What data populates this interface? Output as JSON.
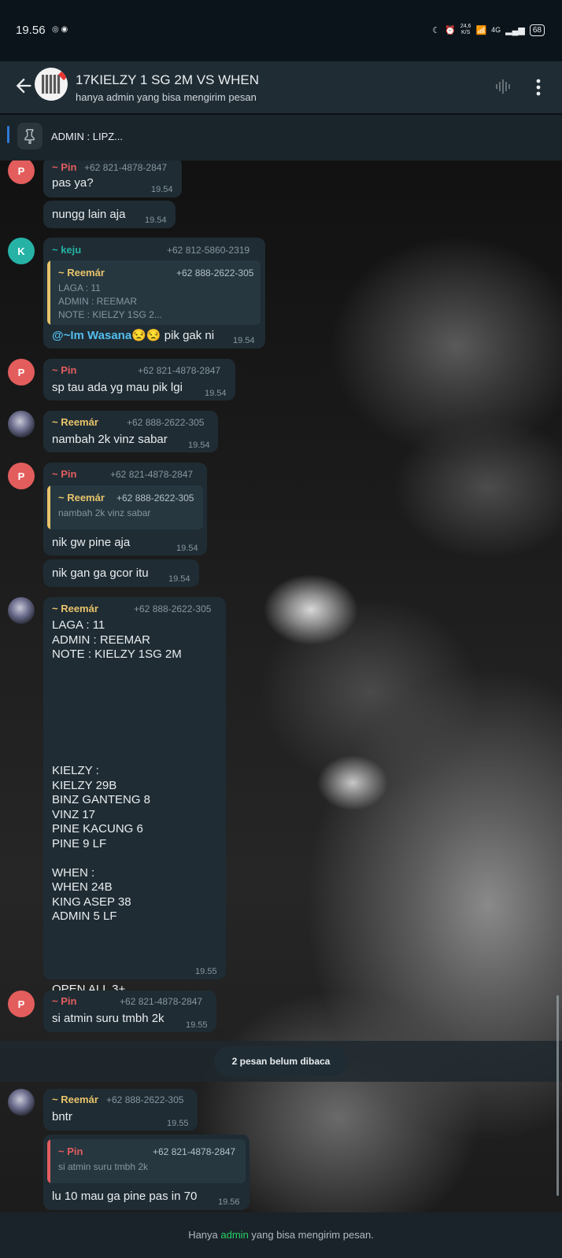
{
  "status_bar": {
    "time": "19.56",
    "speed": "24,6",
    "speed_unit": "K/S",
    "network": "4G",
    "battery": "68"
  },
  "header": {
    "title": "17KIELZY 1 SG 2M VS WHEN",
    "subtitle": "hanya admin yang bisa mengirim pesan"
  },
  "pinned": {
    "text": "ADMIN : LIPZ..."
  },
  "colors": {
    "pin": "#e35d5d",
    "keju": "#26b3a6",
    "reemar": "#e8c36a",
    "mention": "#53bdeb",
    "admin_link": "#25d366"
  },
  "messages": [
    {
      "initial": "P",
      "name": "~ Pin",
      "phone": "+62 821-4878-2847",
      "text": "pas ya?",
      "time": "19.54"
    },
    {
      "text": "nungg lain aja",
      "time": "19.54"
    },
    {
      "initial": "K",
      "name": "~ keju",
      "phone": "+62 812-5860-2319",
      "quote": {
        "name": "~ Reemár",
        "phone": "+62 888-2622-305",
        "lines": [
          "LAGA : 11",
          "ADMIN : REEMAR",
          "NOTE : KIELZY 1SG 2..."
        ]
      },
      "mention": "@~Im Wasana",
      "emoji": "😒😒",
      "text": " pik gak ni",
      "time": "19.54"
    },
    {
      "initial": "P",
      "name": "~ Pin",
      "phone": "+62 821-4878-2847",
      "text": "sp tau ada yg mau pik lgi",
      "time": "19.54"
    },
    {
      "name": "~ Reemár",
      "phone": "+62 888-2622-305",
      "text": "nambah 2k vinz sabar",
      "time": "19.54"
    },
    {
      "initial": "P",
      "name": "~ Pin",
      "phone": "+62 821-4878-2847",
      "quote": {
        "name": "~ Reemár",
        "phone": "+62 888-2622-305",
        "lines": [
          "nambah 2k vinz sabar"
        ]
      },
      "text": "nik gw pine aja",
      "time": "19.54"
    },
    {
      "text": "nik gan ga gcor itu",
      "time": "19.54"
    },
    {
      "name": "~ Reemár",
      "phone": "+62 888-2622-305",
      "text": "LAGA : 11\nADMIN : REEMAR\nNOTE : KIELZY 1SG 2M\n\n\n\n\n\n\n\nKIELZY :\nKIELZY 29B\nBINZ GANTENG 8\nVINZ 17\nPINE KACUNG 6\nPINE 9 LF\n\nWHEN :\nWHEN 24B\nKING ASEP 38\nADMIN 5 LF\n\n\n\n\nOPEN ALL 3+",
      "time": "19.55"
    },
    {
      "initial": "P",
      "name": "~ Pin",
      "phone": "+62 821-4878-2847",
      "text": "si atmin suru tmbh 2k",
      "time": "19.55"
    },
    {
      "name": "~ Reemár",
      "phone": "+62 888-2622-305",
      "text": "bntr",
      "time": "19.55"
    },
    {
      "quote": {
        "name": "~ Pin",
        "phone": "+62 821-4878-2847",
        "lines": [
          "si atmin suru tmbh 2k"
        ]
      },
      "text": "lu 10 mau ga pine pas in 70",
      "time": "19.56"
    }
  ],
  "unread_label": "2 pesan belum dibaca",
  "footer": {
    "before": "Hanya ",
    "link": "admin",
    "after": " yang bisa mengirim pesan."
  }
}
